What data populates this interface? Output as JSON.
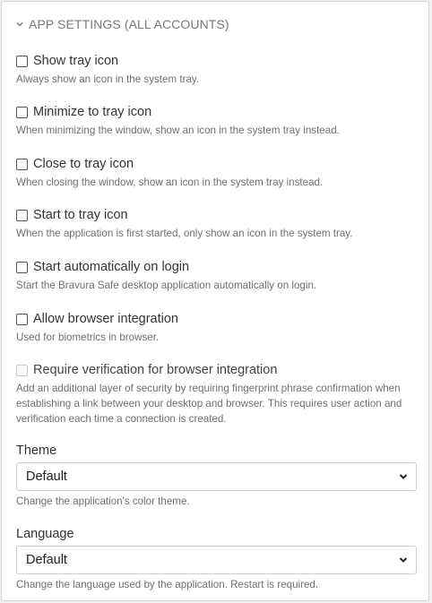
{
  "section": {
    "title": "APP SETTINGS (ALL ACCOUNTS)",
    "chevron_icon": "chevron-down-icon"
  },
  "options": [
    {
      "label": "Show tray icon",
      "help": "Always show an icon in the system tray.",
      "checked": false,
      "disabled": false
    },
    {
      "label": "Minimize to tray icon",
      "help": "When minimizing the window, show an icon in the system tray instead.",
      "checked": false,
      "disabled": false
    },
    {
      "label": "Close to tray icon",
      "help": "When closing the window, show an icon in the system tray instead.",
      "checked": false,
      "disabled": false
    },
    {
      "label": "Start to tray icon",
      "help": "When the application is first started, only show an icon in the system tray.",
      "checked": false,
      "disabled": false
    },
    {
      "label": "Start automatically on login",
      "help": "Start the Bravura Safe desktop application automatically on login.",
      "checked": false,
      "disabled": false
    },
    {
      "label": "Allow browser integration",
      "help": "Used for biometrics in browser.",
      "checked": false,
      "disabled": false
    },
    {
      "label": "Require verification for browser integration",
      "help": "Add an additional layer of security by requiring fingerprint phrase confirmation when establishing a link between your desktop and browser. This requires user action and verification each time a connection is created.",
      "checked": false,
      "disabled": true
    }
  ],
  "theme": {
    "label": "Theme",
    "value": "Default",
    "help": "Change the application's color theme."
  },
  "language": {
    "label": "Language",
    "value": "Default",
    "help": "Change the language used by the application. Restart is required."
  },
  "colors": {
    "panel_bg": "#ffffff",
    "page_bg": "#f0f0f0",
    "help_text": "#6f6f6f",
    "header_text": "#777777"
  }
}
